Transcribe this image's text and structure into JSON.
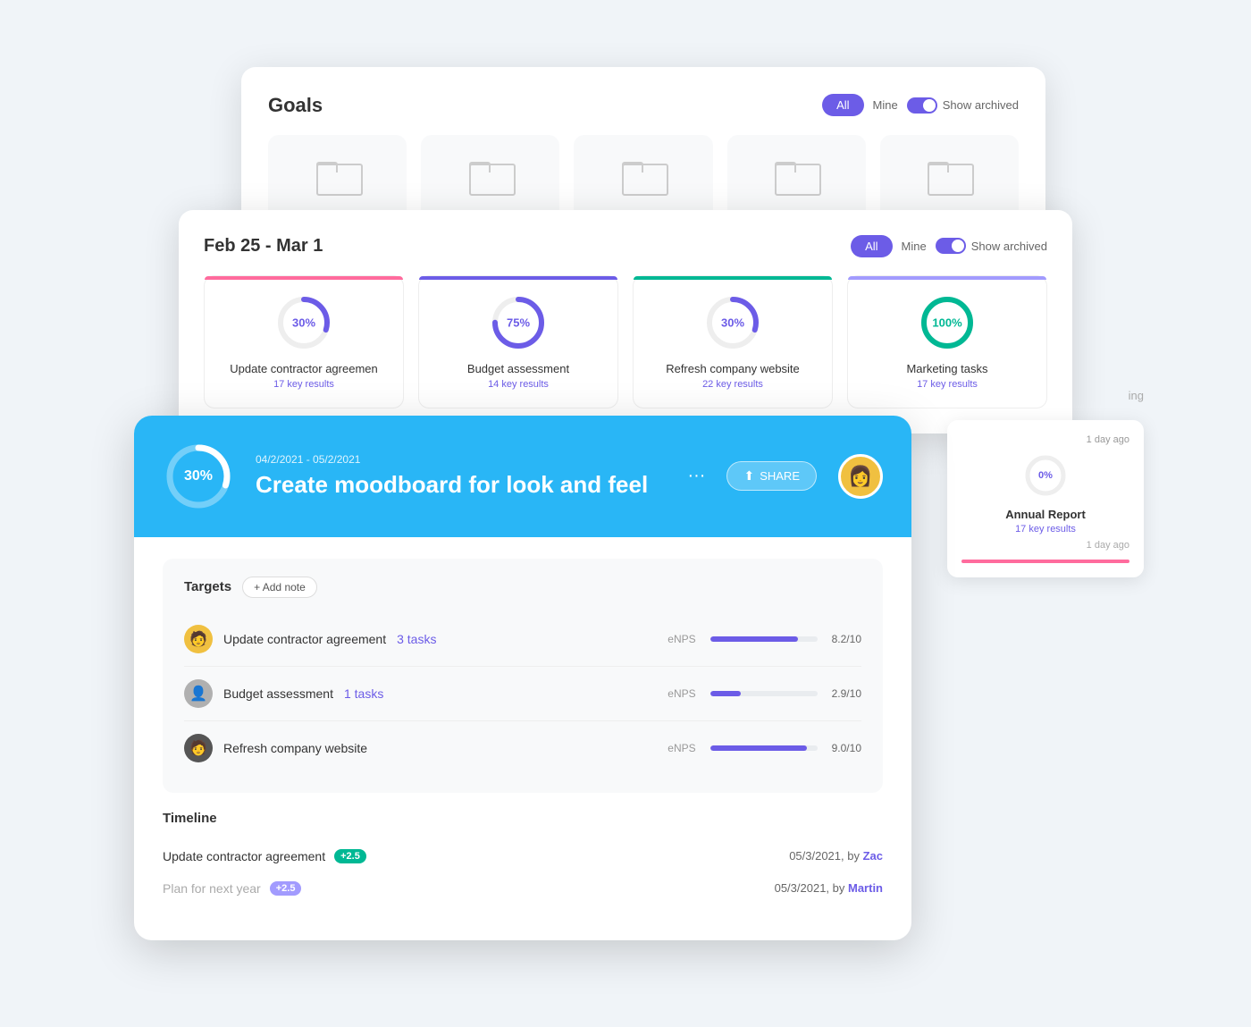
{
  "goals_panel": {
    "title": "Goals",
    "filter_all": "All",
    "filter_mine": "Mine",
    "filter_toggle_label": "Show archived"
  },
  "week_panel": {
    "title": "Feb 25 - Mar 1",
    "filter_all": "All",
    "filter_mine": "Mine",
    "filter_toggle_label": "Show archived",
    "right_label": "ing",
    "goal_cards": [
      {
        "color": "pink",
        "percent": 30,
        "name": "Update contractor agreemen",
        "sub": "17 key results"
      },
      {
        "color": "blue",
        "percent": 75,
        "name": "Budget assessment",
        "sub": "14 key results"
      },
      {
        "color": "green",
        "percent": 30,
        "name": "Refresh company website",
        "sub": "22 key results"
      },
      {
        "color": "purple",
        "percent": 100,
        "name": "Marketing tasks",
        "sub": "17 key results"
      }
    ]
  },
  "right_cards": [
    {
      "time": "1 day ago",
      "percent": 0,
      "name": "Annual Report",
      "sub": "17 key results",
      "bar_color": "#ff6b9d"
    }
  ],
  "detail_panel": {
    "date": "04/2/2021 - 05/2/2021",
    "title": "Create moodboard for look and feel",
    "percent": 30,
    "share_label": "SHARE",
    "targets_title": "Targets",
    "add_note_label": "+ Add note",
    "targets": [
      {
        "name": "Update contractor agreement",
        "link_text": "3 tasks",
        "metric": "eNPS",
        "score": "8.2/10",
        "fill_pct": 82
      },
      {
        "name": "Budget assessment",
        "link_text": "1 tasks",
        "metric": "eNPS",
        "score": "2.9/10",
        "fill_pct": 29
      },
      {
        "name": "Refresh company website",
        "link_text": "",
        "metric": "eNPS",
        "score": "9.0/10",
        "fill_pct": 90
      }
    ],
    "timeline_title": "Timeline",
    "timeline_rows": [
      {
        "name": "Update contractor agreement",
        "badge": "+2.5",
        "date": "05/3/2021, by",
        "author": "Zac",
        "muted": false
      },
      {
        "name": "Plan for next year",
        "badge": "+2.5",
        "date": "05/3/2021, by",
        "author": "Martin",
        "muted": true
      }
    ]
  }
}
